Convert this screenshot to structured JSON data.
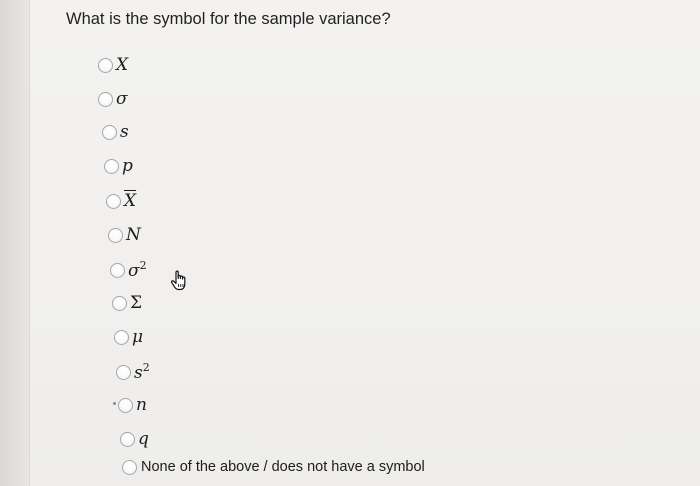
{
  "question": "What is the symbol for the sample variance?",
  "options": [
    {
      "symbol": "X"
    },
    {
      "symbol": "σ"
    },
    {
      "symbol": "s"
    },
    {
      "symbol": "p"
    },
    {
      "symbol": "X"
    },
    {
      "symbol": "N"
    },
    {
      "symbol": "σ",
      "superscript": "2"
    },
    {
      "symbol": "Σ"
    },
    {
      "symbol": "μ"
    },
    {
      "symbol": "s",
      "superscript": "2"
    },
    {
      "symbol": "n"
    },
    {
      "symbol": "q"
    },
    {
      "symbol": "None of the above / does not have a symbol"
    }
  ],
  "icons": {
    "cursor": "hand-pointer-icon"
  }
}
